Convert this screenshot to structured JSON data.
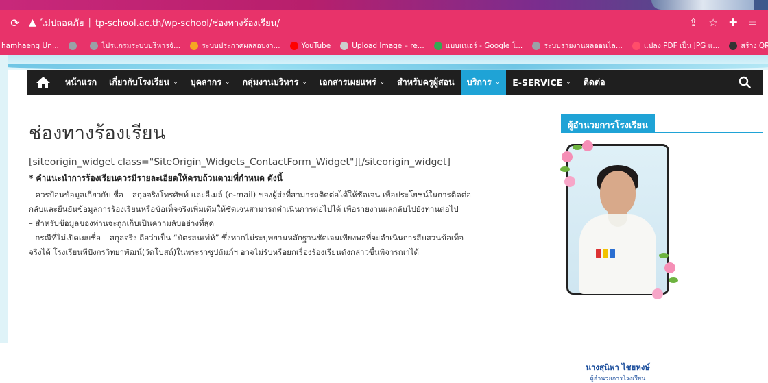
{
  "browser": {
    "security_label": "ไม่ปลอดภัย",
    "url": "tp-school.ac.th/wp-school/ช่องทางร้องเรียน/",
    "reload_icon": "reload-icon",
    "bookmarks": [
      {
        "label": "hamhaeng Un...",
        "color": "#ffffff"
      },
      {
        "label": "",
        "color": "#9aa0a6"
      },
      {
        "label": "โปรแกรมระบบบริหารจั...",
        "color": "#9aa0a6"
      },
      {
        "label": "ระบบประกาศผลสอบงา...",
        "color": "#f5a623"
      },
      {
        "label": "YouTube",
        "color": "#ff0000"
      },
      {
        "label": "Upload Image – re...",
        "color": "#cccccc"
      },
      {
        "label": "แบบแนอร์ - Google โ...",
        "color": "#34a853"
      },
      {
        "label": "ระบบรายงานผลออนไล...",
        "color": "#9aa0a6"
      },
      {
        "label": "แปลง PDF เป็น JPG แ...",
        "color": "#ff4d6a"
      },
      {
        "label": "สร้าง QR C",
        "color": "#333333"
      }
    ]
  },
  "nav": {
    "items": [
      {
        "label": "หน้าแรก",
        "has_dropdown": false,
        "active": false
      },
      {
        "label": "เกี่ยวกับโรงเรียน",
        "has_dropdown": true,
        "active": false
      },
      {
        "label": "บุคลากร",
        "has_dropdown": true,
        "active": false
      },
      {
        "label": "กลุ่มงานบริหาร",
        "has_dropdown": true,
        "active": false
      },
      {
        "label": "เอกสารเผยแพร่",
        "has_dropdown": true,
        "active": false
      },
      {
        "label": "สำหรับครูผู้สอน",
        "has_dropdown": false,
        "active": false
      },
      {
        "label": "บริการ",
        "has_dropdown": true,
        "active": true
      },
      {
        "label": "E-SERVICE",
        "has_dropdown": true,
        "active": false
      },
      {
        "label": "ติดต่อ",
        "has_dropdown": false,
        "active": false
      }
    ],
    "chevron": "⌄"
  },
  "content": {
    "title": "ช่องทางร้องเรียน",
    "shortcode": "[siteorigin_widget class=\"SiteOrigin_Widgets_ContactForm_Widget\"][/siteorigin_widget]",
    "heading": "* คำแนะนำการร้องเรียนควรมีรายละเอียดให้ครบถ้วนตามที่กำหนด ดังนี้",
    "lines": [
      "– ควรป้อนข้อมูลเกี่ยวกับ ชื่อ – สกุลจริงโทรศัพท์ และอีเมล์ (e-mail) ของผู้ส่งที่สามารถติดต่อได้ให้ชัดเจน เพื่อประโยชน์ในการติดต่อ",
      "กลับและยืนยันข้อมูลการร้องเรียนหรือข้อเท็จจริงเพิ่มเติมให้ชัดเจนสามารถดำเนินการต่อไปได้ เพื่อรายงานผลกลับไปยังท่านต่อไป",
      "– สำหรับข้อมูลของท่านจะถูกเก็บเป็นความลับอย่างที่สุด",
      "– กรณีที่ไม่เปิดเผยชื่อ – สกุลจริง ถือว่าเป็น “บัตรสนเท่ห์” ซึ่งหากไม่ระบุพยานหลักฐานชัดเจนเพียงพอที่จะดำเนินการสืบสวนข้อเท็จ",
      "จริงได้ โรงเรียนทีปังกรวิทยาพัฒน์(วัดโบสถ์)ในพระราชูปถัมภ์ฯ อาจไม่รับหรือยกเรื่องร้องเรียนดังกล่าวขึ้นพิจารณาได้"
    ]
  },
  "sidebar": {
    "widget_title": "ผู้อำนวยการโรงเรียน",
    "name": "นางสุนิพา ไชยหงษ์",
    "role": "ผู้อำนวยการโรงเรียน"
  },
  "colors": {
    "browser_chrome": "#e8336a",
    "nav_bg": "#1f1f1f",
    "accent": "#1fa3d6"
  }
}
